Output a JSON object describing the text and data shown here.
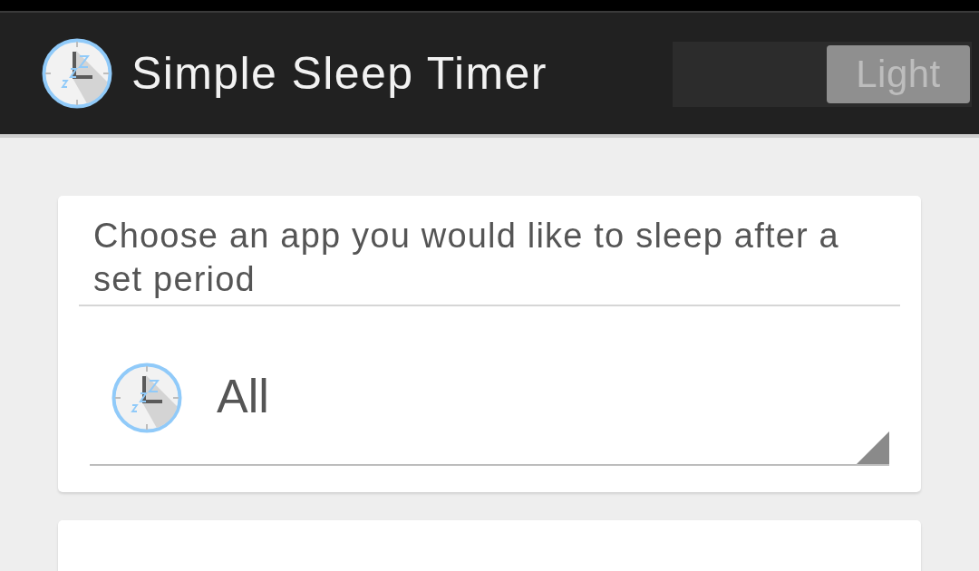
{
  "action_bar": {
    "title": "Simple Sleep Timer",
    "theme_switch": {
      "label": "Light",
      "on": true
    }
  },
  "app_card": {
    "prompt": "Choose an app you would like to sleep after a set period",
    "spinner": {
      "value": "All"
    }
  }
}
